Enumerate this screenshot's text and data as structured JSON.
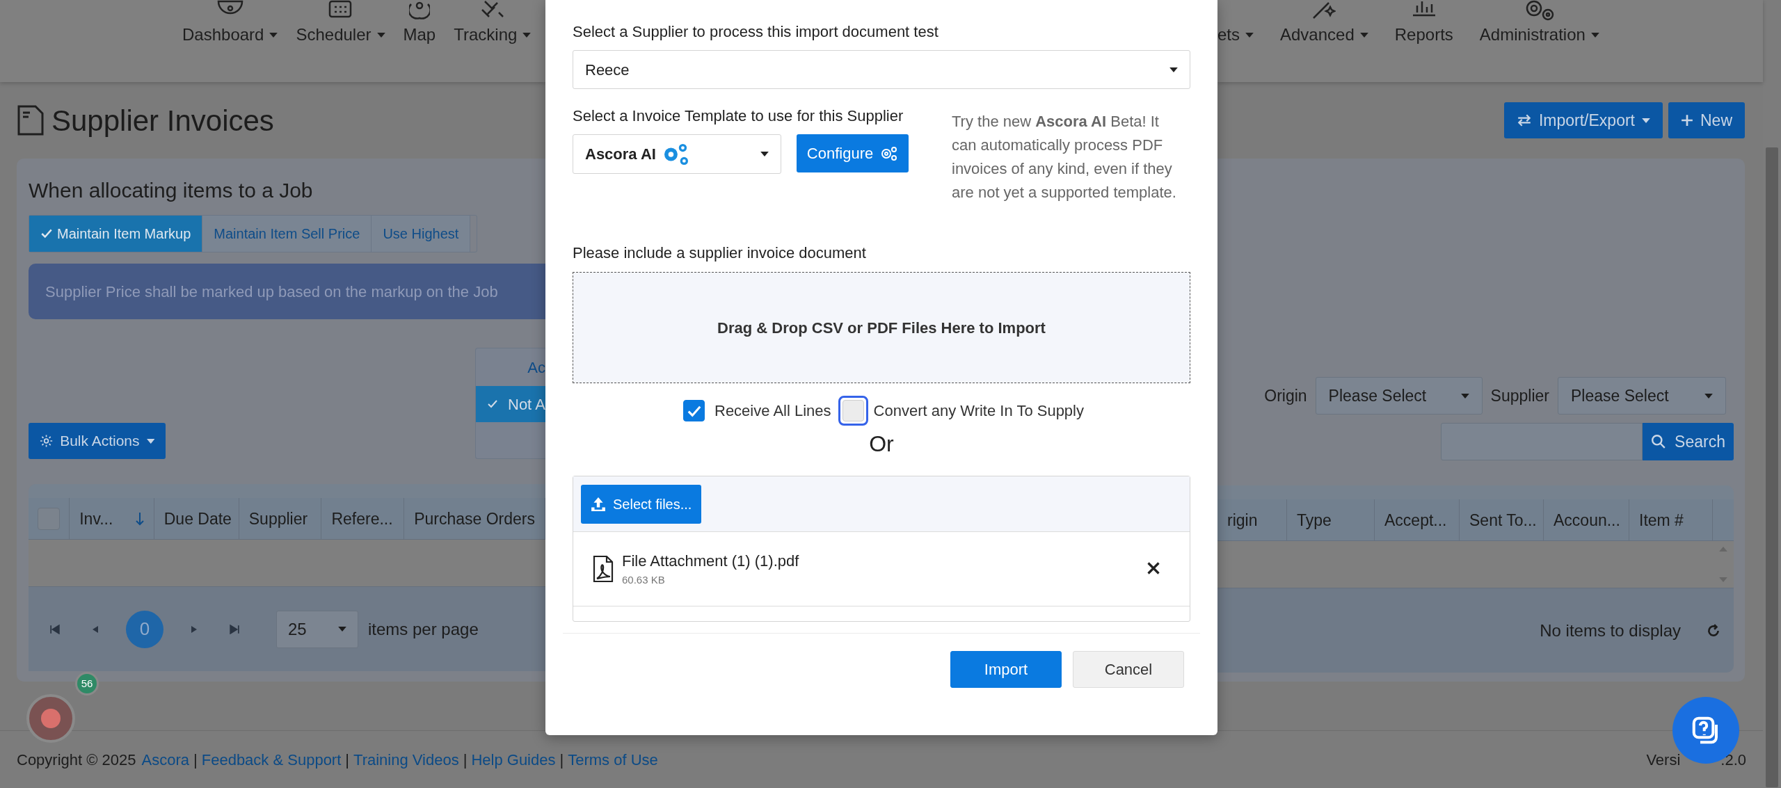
{
  "nav": {
    "items": [
      {
        "label": "Dashboard",
        "dropdown": true
      },
      {
        "label": "Scheduler",
        "dropdown": true
      },
      {
        "label": "Map",
        "dropdown": false
      },
      {
        "label": "Tracking",
        "dropdown": true
      }
    ],
    "items_right": [
      {
        "label": "ets",
        "dropdown": true
      },
      {
        "label": "Advanced",
        "dropdown": true
      },
      {
        "label": "Reports",
        "dropdown": false
      },
      {
        "label": "Administration",
        "dropdown": true
      }
    ]
  },
  "page": {
    "title": "Supplier Invoices",
    "buttons": [
      {
        "label": "Import/Export",
        "dropdown": true
      },
      {
        "label": "New",
        "dropdown": false
      }
    ]
  },
  "allocation": {
    "heading": "When allocating items to a Job",
    "options": [
      {
        "label": "Maintain Item Markup",
        "selected": true
      },
      {
        "label": "Maintain Item Sell Price",
        "selected": false
      },
      {
        "label": "Use Highest",
        "selected": false
      }
    ],
    "info": "Supplier Price shall be marked up based on the markup on the Job"
  },
  "accepted_filter": {
    "header": "Ac",
    "options": [
      {
        "label": "Not A",
        "selected": true
      }
    ]
  },
  "bulk_actions": {
    "label": "Bulk Actions"
  },
  "filters": {
    "origin": {
      "label": "Origin",
      "value": "Please Select"
    },
    "supplier": {
      "label": "Supplier",
      "value": "Please Select"
    },
    "search_button": "Search"
  },
  "table": {
    "select_all_checked": false,
    "columns_left": [
      {
        "label": "Inv...",
        "sorted": true
      },
      {
        "label": "Due Date",
        "sorted": false
      },
      {
        "label": "Supplier",
        "sorted": false
      },
      {
        "label": "Refere...",
        "sorted": false
      },
      {
        "label": "Purchase Orders",
        "sorted": false
      }
    ],
    "columns_right": [
      {
        "label": "rigin",
        "sorted": false
      },
      {
        "label": "Type",
        "sorted": false
      },
      {
        "label": "Accept...",
        "sorted": false
      },
      {
        "label": "Sent To...",
        "sorted": false
      },
      {
        "label": "Accoun...",
        "sorted": false
      },
      {
        "label": "Item #",
        "sorted": false
      }
    ],
    "pager": {
      "page": "0",
      "page_size": "25",
      "per_page_label": "items per page",
      "status": "No items to display"
    }
  },
  "modal": {
    "supplier_label": "Select a Supplier to process this import document test",
    "supplier_value": "Reece",
    "template_label": "Select a Invoice Template to use for this Supplier",
    "template_value": "Ascora AI",
    "configure_button": "Configure",
    "beta_note": "Try the new **Ascora AI** Beta! It can automatically process PDF invoices of any kind, even if they are not yet a supported template.",
    "document_label": "Please include a supplier invoice document",
    "dropzone": "Drag & Drop CSV or PDF Files Here to Import",
    "options": [
      {
        "label": "Receive All Lines",
        "checked": true,
        "focused": false
      },
      {
        "label": "Convert any Write In To Supply",
        "checked": false,
        "focused": true
      }
    ],
    "or": "Or",
    "select_files": "Select files...",
    "files": [
      {
        "name": "File Attachment (1) (1).pdf",
        "size": "60.63 KB"
      }
    ],
    "buttons": [
      {
        "label": "Import",
        "kind": "primary"
      },
      {
        "label": "Cancel",
        "kind": "secondary"
      }
    ]
  },
  "footer": {
    "copyright": "Copyright © 2025",
    "links": [
      "Ascora",
      "Feedback & Support",
      "Training Videos",
      "Help Guides",
      "Terms of Use"
    ],
    "separator": "|",
    "version_start": "Versi",
    "version_end": ".2.0"
  },
  "recording_badge": {
    "count": "56"
  }
}
